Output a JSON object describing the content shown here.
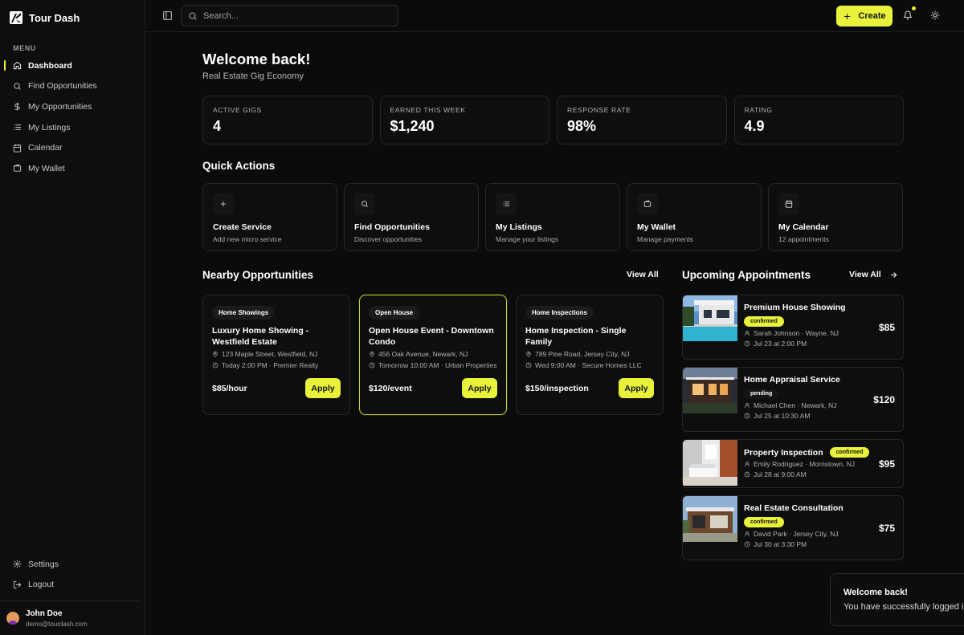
{
  "brand": {
    "name": "Tour Dash"
  },
  "sidebar": {
    "menu_label": "MENU",
    "items": [
      {
        "label": "Dashboard",
        "icon": "home-icon",
        "active": true
      },
      {
        "label": "Find Opportunities",
        "icon": "search-icon"
      },
      {
        "label": "My Opportunities",
        "icon": "dollar-icon"
      },
      {
        "label": "My Listings",
        "icon": "list-icon"
      },
      {
        "label": "Calendar",
        "icon": "calendar-icon"
      },
      {
        "label": "My Wallet",
        "icon": "wallet-icon"
      }
    ],
    "bottom": [
      {
        "label": "Settings",
        "icon": "gear-icon"
      },
      {
        "label": "Logout",
        "icon": "logout-icon"
      }
    ],
    "user": {
      "name": "John Doe",
      "email": "demo@tourdash.com"
    }
  },
  "topbar": {
    "search_placeholder": "Search...",
    "create_label": "Create"
  },
  "header": {
    "title": "Welcome back!",
    "subtitle": "Real Estate Gig Economy"
  },
  "stats": [
    {
      "label": "ACTIVE GIGS",
      "value": "4"
    },
    {
      "label": "EARNED THIS WEEK",
      "value": "$1,240"
    },
    {
      "label": "RESPONSE RATE",
      "value": "98%"
    },
    {
      "label": "RATING",
      "value": "4.9"
    }
  ],
  "quick_actions": {
    "title": "Quick Actions",
    "items": [
      {
        "title": "Create Service",
        "desc": "Add new micro service",
        "icon": "plus-icon"
      },
      {
        "title": "Find Opportunities",
        "desc": "Discover opportunities",
        "icon": "search-icon"
      },
      {
        "title": "My Listings",
        "desc": "Manage your listings",
        "icon": "list-icon"
      },
      {
        "title": "My Wallet",
        "desc": "Manage payments",
        "icon": "wallet-icon"
      },
      {
        "title": "My Calendar",
        "desc": "12 appointments",
        "icon": "calendar-icon"
      }
    ]
  },
  "nearby": {
    "title": "Nearby Opportunities",
    "view_all": "View All",
    "apply_label": "Apply",
    "items": [
      {
        "badge": "Home Showings",
        "title": "Luxury Home Showing - Westfield Estate",
        "address": "123 Maple Street, Westfield, NJ",
        "time": "Today 2:00 PM · Premier Realty",
        "price": "$85/hour"
      },
      {
        "badge": "Open House",
        "title": "Open House Event - Downtown Condo",
        "address": "456 Oak Avenue, Newark, NJ",
        "time": "Tomorrow 10:00 AM · Urban Properties",
        "price": "$120/event"
      },
      {
        "badge": "Home Inspections",
        "title": "Home Inspection - Single Family",
        "address": "789 Pine Road, Jersey City, NJ",
        "time": "Wed 9:00 AM · Secure Homes LLC",
        "price": "$150/inspection"
      }
    ]
  },
  "appointments": {
    "title": "Upcoming Appointments",
    "view_all": "View All",
    "items": [
      {
        "title": "Premium House Showing",
        "status": "confirmed",
        "person": "Sarah Johnson · Wayne, NJ",
        "time": "Jul 23 at 2:00 PM",
        "price": "$85"
      },
      {
        "title": "Home Appraisal Service",
        "status": "pending",
        "person": "Michael Chen · Newark, NJ",
        "time": "Jul 25 at 10:30 AM",
        "price": "$120"
      },
      {
        "title": "Property Inspection",
        "status": "confirmed",
        "person": "Emily Rodriguez · Morristown, NJ",
        "time": "Jul 28 at 9:00 AM",
        "price": "$95"
      },
      {
        "title": "Real Estate Consultation",
        "status": "confirmed",
        "person": "David Park · Jersey City, NJ",
        "time": "Jul 30 at 3:30 PM",
        "price": "$75"
      }
    ]
  },
  "toast": {
    "title": "Welcome back!",
    "message": "You have successfully logged in"
  },
  "colors": {
    "accent": "#e8f23a",
    "background": "#0b0b0b",
    "card": "#0e0e0e",
    "border": "#262626"
  }
}
